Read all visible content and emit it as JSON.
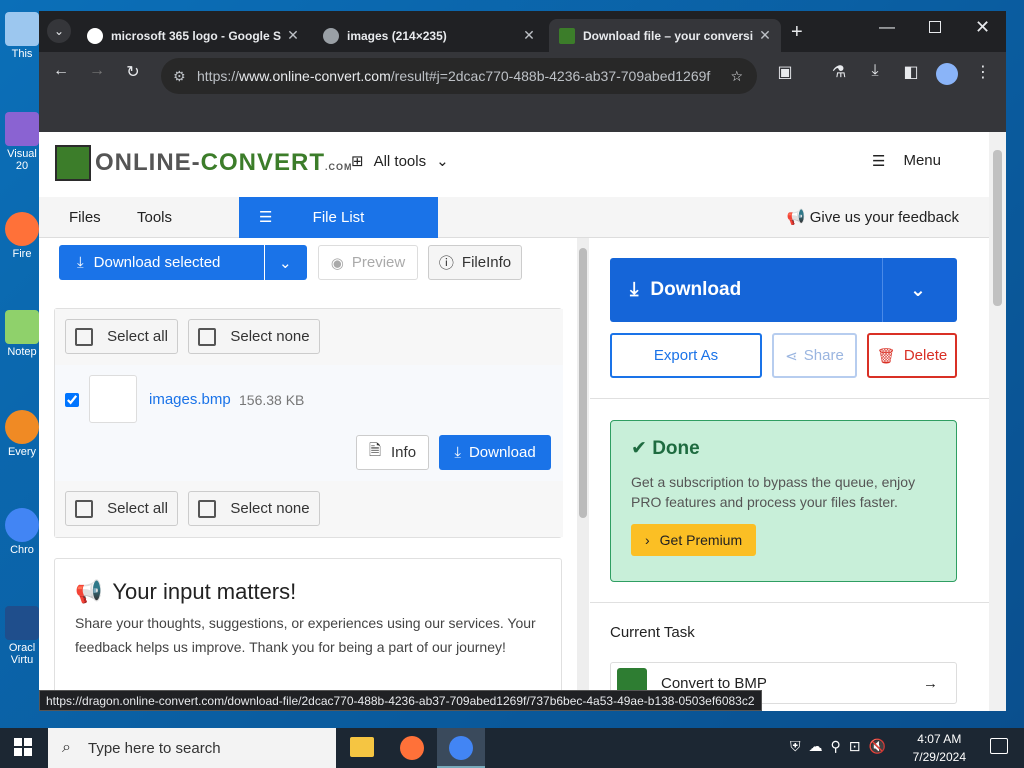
{
  "desktop": {
    "icons": [
      "This",
      "Visual\n20",
      "Fire",
      "Notep",
      "Every",
      "Chro",
      "Oracl\nVirtu"
    ]
  },
  "browser": {
    "tabs": [
      {
        "title": "microsoft 365 logo - Google S"
      },
      {
        "title": "images (214×235)"
      },
      {
        "title": "Download file – your conversi"
      }
    ],
    "url_scheme": "https://",
    "url_host": "www.online-convert.com",
    "url_path": "/result#j=2dcac770-488b-4236-ab37-709abed1269f",
    "status_url": "https://dragon.online-convert.com/download-file/2dcac770-488b-4236-ab37-709abed1269f/737b6bec-4a53-49ae-b138-0503ef6083c2"
  },
  "site": {
    "logo_a": "ONLINE-",
    "logo_b": "CONVERT",
    "logo_c": ".COM",
    "all_tools": "All tools",
    "menu": "Menu",
    "nav_files": "Files",
    "nav_tools": "Tools",
    "nav_filelist": "File List",
    "feedback": "Give us your feedback"
  },
  "left": {
    "download_selected": "Download selected",
    "preview": "Preview",
    "fileinfo": "FileInfo",
    "select_all": "Select all",
    "select_none": "Select none",
    "file_name": "images.bmp",
    "file_size": "156.38 KB",
    "info": "Info",
    "download": "Download",
    "input_title": "Your input matters!",
    "input_text": "Share your thoughts, suggestions, or experiences using our services. Your feedback helps us improve. Thank you for being a part of our journey!"
  },
  "right": {
    "download": "Download",
    "export_as": "Export As",
    "share": "Share",
    "delete": "Delete",
    "done_title": "Done",
    "done_text": "Get a subscription to bypass the queue, enjoy PRO features and process your files faster.",
    "get_premium": "Get Premium",
    "current_task": "Current Task",
    "task_name": "Convert to BMP"
  },
  "taskbar": {
    "search_placeholder": "Type here to search",
    "time": "4:07 AM",
    "date": "7/29/2024"
  },
  "colors": {
    "primary": "#1a73e8",
    "brand_green": "#3c7d2a",
    "done_bg": "#c8efd9",
    "delete_red": "#d93025",
    "premium": "#fbbf24"
  }
}
